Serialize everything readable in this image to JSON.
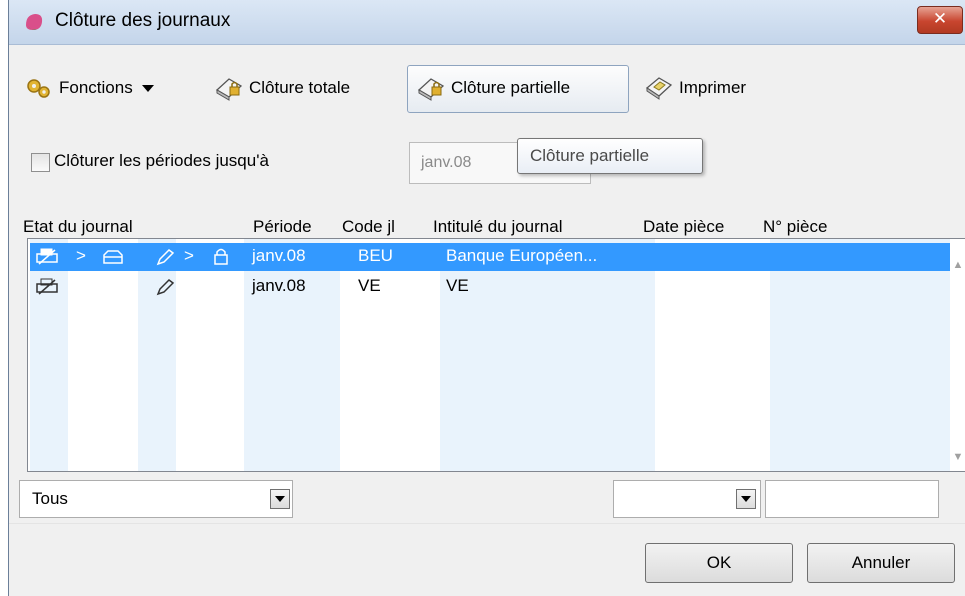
{
  "window": {
    "title": "Clôture des journaux",
    "close_glyph": "✕"
  },
  "toolbar": {
    "functions_label": "Fonctions",
    "total_label": "Clôture totale",
    "partial_label": "Clôture partielle",
    "print_label": "Imprimer"
  },
  "filter": {
    "checkbox_label": "Clôturer les périodes jusqu'à",
    "date_value": "janv.08"
  },
  "tooltip": {
    "text": "Clôture partielle"
  },
  "table": {
    "headers": {
      "etat": "Etat du journal",
      "periode": "Période",
      "code": "Code jl",
      "intitule": "Intitulé du journal",
      "date_piece": "Date pièce",
      "num_piece": "N° pièce"
    },
    "rows": [
      {
        "periode": "janv.08",
        "code": "BEU",
        "intitule": "Banque Européen...",
        "arrow1": ">",
        "arrow2": ">",
        "selected": true
      },
      {
        "periode": "janv.08",
        "code": "VE",
        "intitule": "VE",
        "selected": false
      }
    ]
  },
  "bottom": {
    "state_filter": "Tous",
    "date_filter": "",
    "num_filter": ""
  },
  "buttons": {
    "ok": "OK",
    "cancel": "Annuler"
  },
  "colors": {
    "selection": "#3399ff",
    "column_band": "#e9f3fc",
    "close": "#c8452f"
  }
}
